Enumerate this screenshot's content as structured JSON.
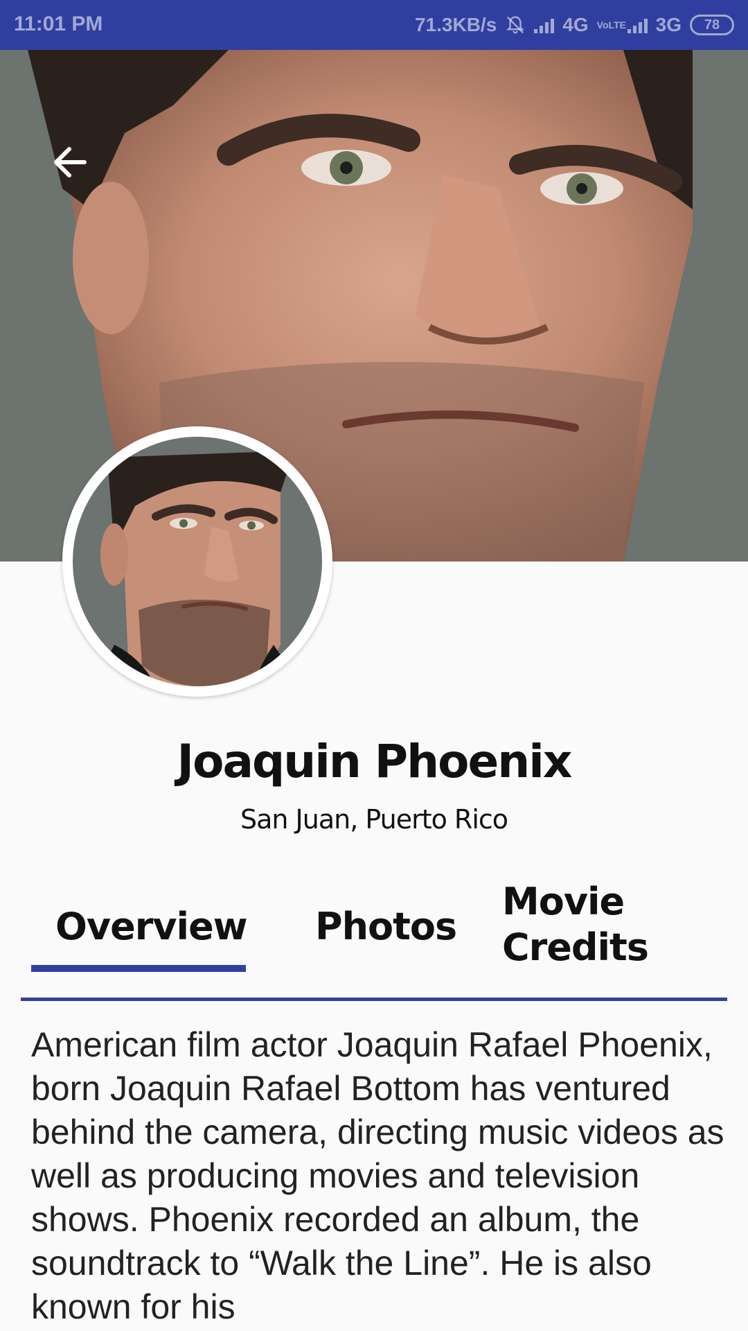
{
  "status_bar": {
    "time": "11:01 PM",
    "speed": "71.3KB/s",
    "network_1": "4G",
    "volte": "VoLTE",
    "network_2": "3G",
    "battery": "78",
    "icons": [
      "bell-muted-icon",
      "signal-icon",
      "signal-icon",
      "battery-icon"
    ]
  },
  "header": {
    "back_icon": "arrow-left-icon",
    "backdrop_image": "actor close-up backdrop photo",
    "avatar_image": "actor profile photo"
  },
  "person": {
    "name": "Joaquin Phoenix",
    "place_of_birth": "San Juan, Puerto Rico"
  },
  "tabs": [
    {
      "label": "Overview",
      "selected": true
    },
    {
      "label": "Photos",
      "selected": false
    },
    {
      "label": "Movie Credits",
      "selected": false
    }
  ],
  "accent_color": "#303f9f",
  "overview": {
    "text": "American film actor Joaquin Rafael Phoenix, born Joaquin Rafael Bottom has ventured behind the camera, directing music videos as well as producing movies and television shows. Phoenix recorded an album, the soundtrack to “Walk the Line”. He is also known for his"
  }
}
